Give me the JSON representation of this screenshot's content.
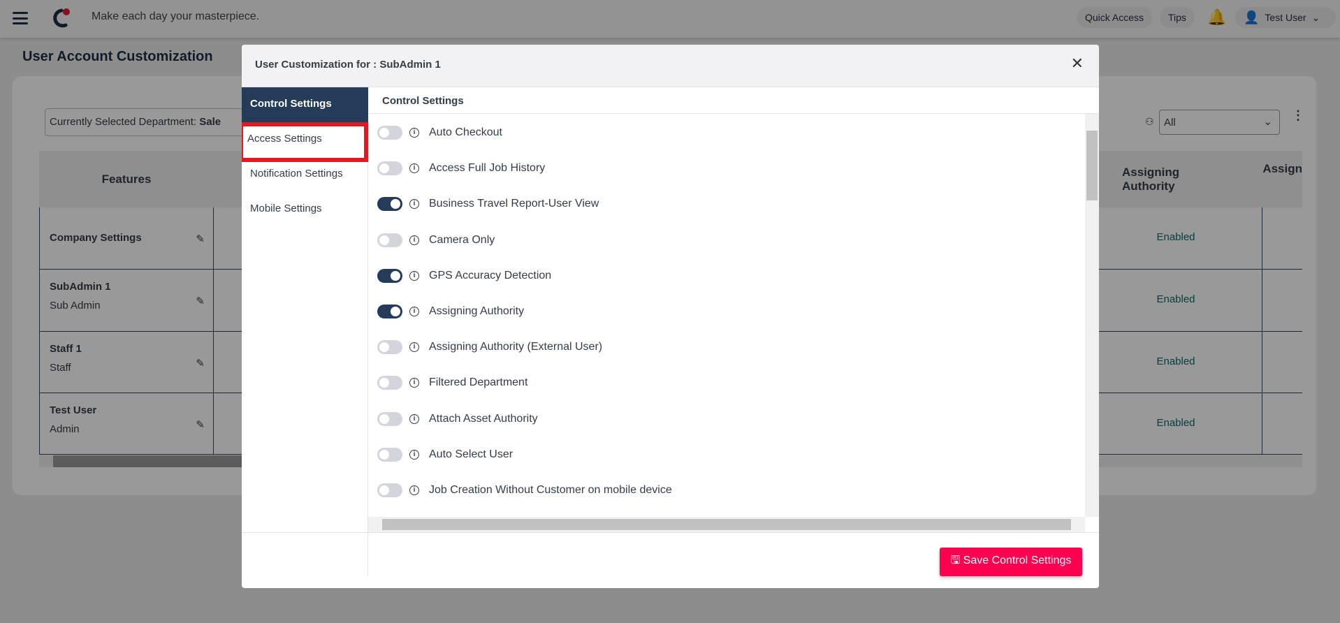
{
  "header": {
    "tagline": "Make each day your masterpiece.",
    "quick_access": "Quick Access",
    "tips": "Tips",
    "user": "Test User",
    "brand_color": "#e5173f"
  },
  "page": {
    "title": "User Account Customization",
    "department_label": "Currently Selected Department:",
    "department_value": "Sale",
    "filter_value": "All"
  },
  "table": {
    "features_header": "Features",
    "assigning_header": "Assigning Authority",
    "assign_partial": "Assign",
    "rows": [
      {
        "name": "Company Settings",
        "role": "",
        "assigning": "Enabled"
      },
      {
        "name": "SubAdmin 1",
        "role": "Sub Admin",
        "assigning": "Enabled"
      },
      {
        "name": "Staff 1",
        "role": "Staff",
        "assigning": "Enabled"
      },
      {
        "name": "Test User",
        "role": "Admin",
        "assigning": "Enabled"
      }
    ]
  },
  "modal": {
    "title": "User Customization for : SubAdmin 1",
    "content_header": "Control Settings",
    "save_label": "Save Control Settings",
    "save_color": "#ff0050",
    "nav": [
      {
        "label": "Control Settings",
        "active": true
      },
      {
        "label": "Access Settings",
        "highlighted": true
      },
      {
        "label": "Notification Settings"
      },
      {
        "label": "Mobile Settings"
      }
    ],
    "settings": [
      {
        "label": "Auto Checkout",
        "on": false
      },
      {
        "label": "Access Full Job History",
        "on": false
      },
      {
        "label": "Business Travel Report-User View",
        "on": true
      },
      {
        "label": "Camera Only",
        "on": false
      },
      {
        "label": "GPS Accuracy Detection",
        "on": true
      },
      {
        "label": "Assigning Authority",
        "on": true
      },
      {
        "label": "Assigning Authority (External User)",
        "on": false
      },
      {
        "label": "Filtered Department",
        "on": false
      },
      {
        "label": "Attach Asset Authority",
        "on": false
      },
      {
        "label": "Auto Select User",
        "on": false
      },
      {
        "label": "Job Creation Without Customer on mobile device",
        "on": false
      }
    ]
  }
}
